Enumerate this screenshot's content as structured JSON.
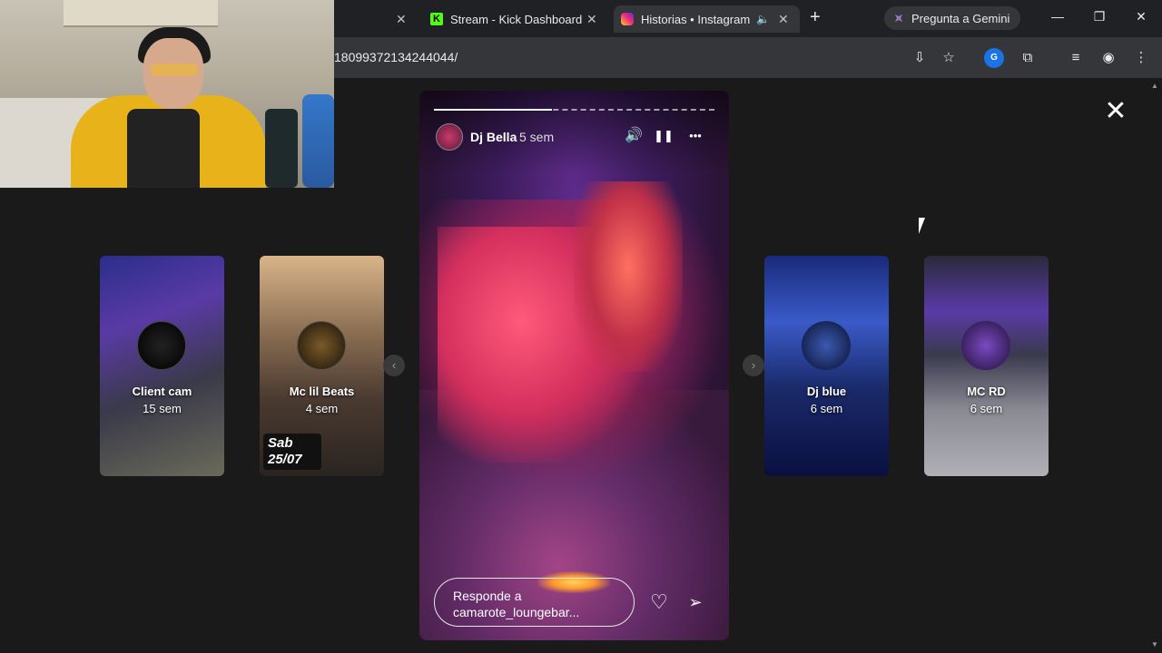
{
  "tabs": [
    {
      "title": "Stream - Kick Dashboard",
      "close": "✕",
      "favicon": "kick-icon"
    },
    {
      "title": "Historias • Instagram",
      "close": "✕",
      "favicon": "instagram-icon",
      "active": true
    }
  ],
  "first_tab_close": "✕",
  "new_tab": "+",
  "gemini": {
    "label": "Pregunta a Gemini"
  },
  "window": {
    "minimize": "—",
    "restore": "❐",
    "close": "✕"
  },
  "address": {
    "url": "18099372134244044/"
  },
  "toolbar_icons": {
    "install": "⇩",
    "bookmark": "☆",
    "ext_g": "G",
    "extensions": "⧉",
    "media": "≡",
    "profile": "◉",
    "menu": "⋮"
  },
  "viewer": {
    "close": "✕",
    "prev": "‹",
    "next": "›"
  },
  "side_stories": [
    {
      "name": "Client cam",
      "age": "15 sem"
    },
    {
      "name": "Mc lil Beats",
      "age": "4 sem",
      "tag": "Sab 25/07"
    },
    {
      "name": "Dj blue",
      "age": "6 sem"
    },
    {
      "name": "MC RD",
      "age": "6 sem"
    }
  ],
  "main_story": {
    "user": "Dj Bella",
    "age": "5 sem",
    "progress": 0.42,
    "reply_placeholder": "Responde a camarote_loungebar...",
    "icons": {
      "sound": "🔊",
      "pause": "❚❚",
      "more": "•••",
      "like": "♡",
      "share": "➢"
    }
  },
  "colors": {
    "page_bg": "#1a1a1a",
    "tabstrip_bg": "#202124",
    "toolbar_bg": "#35363a",
    "kick_green": "#53fc18"
  }
}
